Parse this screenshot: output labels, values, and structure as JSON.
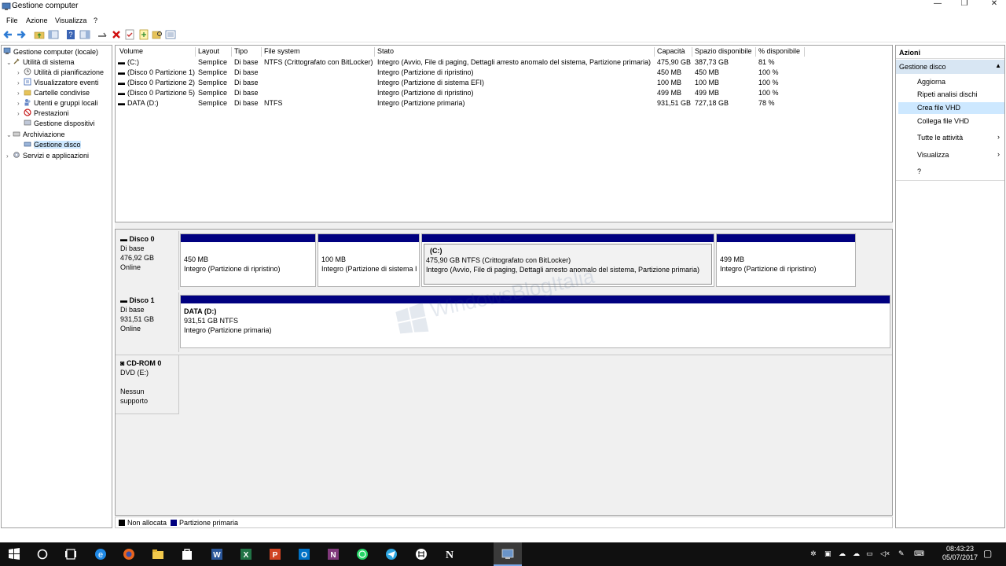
{
  "window": {
    "title": "Gestione computer",
    "minimize": "—",
    "restore": "❐",
    "close": "✕"
  },
  "menu": [
    "File",
    "Azione",
    "Visualizza",
    "?"
  ],
  "tree": {
    "root": "Gestione computer (locale)",
    "system_tools": "Utilità di sistema",
    "task_scheduler": "Utilità di pianificazione",
    "event_viewer": "Visualizzatore eventi",
    "shared_folders": "Cartelle condivise",
    "local_users": "Utenti e gruppi locali",
    "performance": "Prestazioni",
    "device_manager": "Gestione dispositivi",
    "storage": "Archiviazione",
    "disk_management": "Gestione disco",
    "services": "Servizi e applicazioni"
  },
  "volumes": {
    "columns": [
      "Volume",
      "Layout",
      "Tipo",
      "File system",
      "Stato",
      "Capacità",
      "Spazio disponibile",
      "% disponibile"
    ],
    "rows": [
      [
        "(C:)",
        "Semplice",
        "Di base",
        "NTFS (Crittografato con BitLocker)",
        "Integro (Avvio, File di paging, Dettagli arresto anomalo del sistema, Partizione primaria)",
        "475,90 GB",
        "387,73 GB",
        "81 %"
      ],
      [
        "(Disco 0 Partizione 1)",
        "Semplice",
        "Di base",
        "",
        "Integro (Partizione di ripristino)",
        "450 MB",
        "450 MB",
        "100 %"
      ],
      [
        "(Disco 0 Partizione 2)",
        "Semplice",
        "Di base",
        "",
        "Integro (Partizione di sistema EFI)",
        "100 MB",
        "100 MB",
        "100 %"
      ],
      [
        "(Disco 0 Partizione 5)",
        "Semplice",
        "Di base",
        "",
        "Integro (Partizione di ripristino)",
        "499 MB",
        "499 MB",
        "100 %"
      ],
      [
        "DATA (D:)",
        "Semplice",
        "Di base",
        "NTFS",
        "Integro (Partizione primaria)",
        "931,51 GB",
        "727,18 GB",
        "78 %"
      ]
    ]
  },
  "disk0": {
    "name": "Disco 0",
    "type": "Di base",
    "size": "476,92 GB",
    "status": "Online",
    "p1": {
      "size": "450 MB",
      "status": "Integro (Partizione di ripristino)"
    },
    "p2": {
      "size": "100 MB",
      "status": "Integro (Partizione di sistema I"
    },
    "p3": {
      "name": "(C:)",
      "size": "475,90 GB NTFS (Crittografato con BitLocker)",
      "status": "Integro (Avvio, File di paging, Dettagli arresto anomalo del sistema, Partizione primaria)"
    },
    "p4": {
      "size": "499 MB",
      "status": "Integro (Partizione di ripristino)"
    }
  },
  "disk1": {
    "name": "Disco 1",
    "type": "Di base",
    "size": "931,51 GB",
    "status": "Online",
    "p1": {
      "name": "DATA  (D:)",
      "size": "931,51 GB NTFS",
      "status": "Integro (Partizione primaria)"
    }
  },
  "cdrom": {
    "name": "CD-ROM 0",
    "drive": "DVD (E:)",
    "status": "Nessun supporto"
  },
  "legend": {
    "unallocated": "Non allocata",
    "primary": "Partizione primaria",
    "unallocated_color": "#000000",
    "primary_color": "#000080"
  },
  "actions": {
    "header": "Azioni",
    "section": "Gestione disco",
    "items": [
      "Aggiorna",
      "Ripeti analisi dischi",
      "Crea file VHD",
      "Collega file VHD"
    ],
    "all_tasks": "Tutte le attività",
    "view": "Visualizza",
    "help": "?"
  },
  "taskbar": {
    "time": "08:43:23",
    "date": "05/07/2017"
  },
  "watermark": "WindowsBlogItalia"
}
